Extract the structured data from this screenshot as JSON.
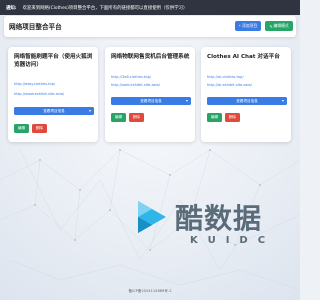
{
  "notice": {
    "label": "通知:",
    "text": "欢迎来到网络(Clothes)项目整合平台，下面所有的链接都可以直接使用（仅供学习）"
  },
  "header": {
    "title": "网络项目整合平台",
    "add_label": "添加项目",
    "mode_label": "编辑模式"
  },
  "cards": [
    {
      "title": "网络智能刷题平台（使用火狐浏览器访问）",
      "link1": "http://easy.clothes.top/",
      "link2": "http://www.exhibit.site.asia/",
      "select_label": "查看项目信息",
      "edit_label": "编辑",
      "delete_label": "删除"
    },
    {
      "title": "网络物联网售货机后台管理系统",
      "link1": "http://3a8.clothes.top/",
      "link2": "http://sale.exhibit.site.asia/",
      "select_label": "查看项目信息",
      "edit_label": "编辑",
      "delete_label": "删除"
    },
    {
      "title": "Clothes AI Chat 对话平台",
      "link1": "http://ai.clothes.top/",
      "link2": "http://ai.exhibit.site.asia/",
      "select_label": "查看项目信息",
      "edit_label": "编辑",
      "delete_label": "删除"
    }
  ],
  "logo": {
    "text": "酷数据",
    "sub": "KUIDC"
  },
  "footer": {
    "text": "备ICP备2024115889号-2"
  },
  "colors": {
    "primary": "#3b7be6",
    "success": "#27a567",
    "danger": "#e04a3c",
    "notice_bg": "#2f3440"
  }
}
